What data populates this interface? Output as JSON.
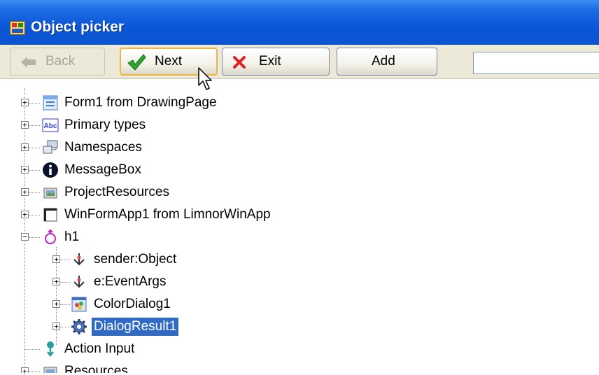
{
  "window": {
    "title": "Object picker"
  },
  "toolbar": {
    "back_label": "Back",
    "next_label": "Next",
    "exit_label": "Exit",
    "add_label": "Add",
    "search_value": ""
  },
  "tree": {
    "items": [
      {
        "label": "Form1 from DrawingPage",
        "icon": "form-icon"
      },
      {
        "label": "Primary types",
        "icon": "abc-icon"
      },
      {
        "label": "Namespaces",
        "icon": "namespaces-icon"
      },
      {
        "label": "MessageBox",
        "icon": "info-icon"
      },
      {
        "label": "ProjectResources",
        "icon": "resources-icon"
      },
      {
        "label": "WinFormApp1 from LimnorWinApp",
        "icon": "window-icon"
      },
      {
        "label": "h1",
        "icon": "handler-icon"
      },
      {
        "label": "sender:Object",
        "icon": "parameter-icon"
      },
      {
        "label": "e:EventArgs",
        "icon": "parameter-icon"
      },
      {
        "label": "ColorDialog1",
        "icon": "color-dialog-icon"
      },
      {
        "label": "DialogResult1",
        "icon": "gear-icon",
        "selected": true
      },
      {
        "label": "Action Input",
        "icon": "action-input-icon"
      },
      {
        "label": "Resources",
        "icon": "resources-icon"
      }
    ]
  },
  "colors": {
    "titlebar": "#0a56d8",
    "selection": "#316ac5",
    "toolbar": "#ece9d8"
  }
}
